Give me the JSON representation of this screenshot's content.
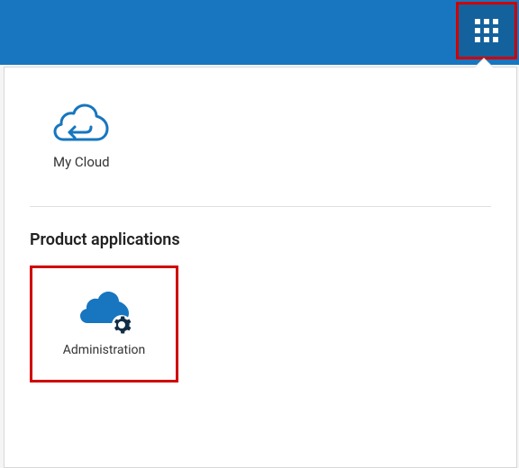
{
  "colors": {
    "brand": "#1776bf",
    "brand_dark": "#14629d",
    "highlight_border": "#d00000",
    "text": "#333333",
    "white": "#ffffff"
  },
  "header": {
    "app_switcher_tooltip": "App switcher"
  },
  "panel": {
    "quick_access": {
      "item_label": "My Cloud"
    },
    "section_title": "Product applications",
    "apps": [
      {
        "label": "Administration"
      }
    ]
  }
}
